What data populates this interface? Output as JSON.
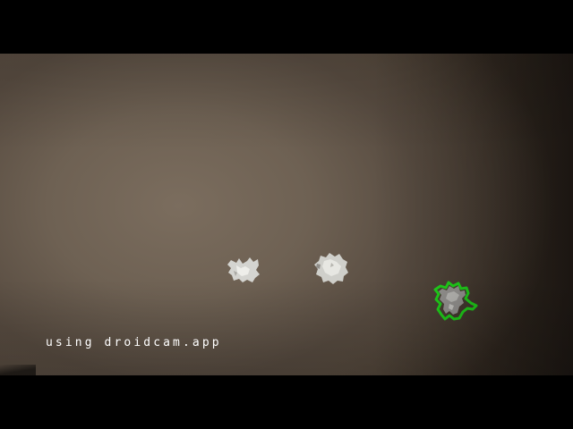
{
  "overlay": {
    "watermark_text": "using droidcam.app"
  },
  "colors": {
    "letterbox": "#000000",
    "wall": "#6e6153",
    "object": "#d8d8d4",
    "detection_outline": "#22e01c"
  },
  "objects": [
    {
      "name": "paper-bit-left",
      "detected": false
    },
    {
      "name": "paper-bit-middle",
      "detected": false
    },
    {
      "name": "paper-bit-right",
      "detected": true
    }
  ]
}
